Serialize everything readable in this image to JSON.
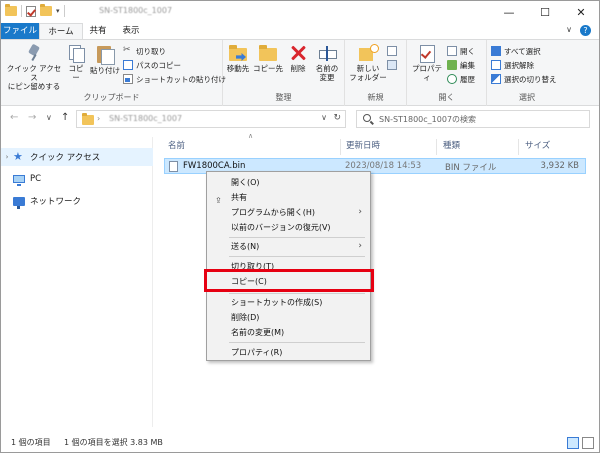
{
  "window": {
    "title": "SN-ST1800c_1007",
    "controls": {
      "minimize": "—",
      "maximize": "☐",
      "close": "✕"
    }
  },
  "quick_access_toolbar": {
    "dropdown": "▾"
  },
  "ribbon_tabs": {
    "file": "ファイル",
    "home": "ホーム",
    "share": "共有",
    "view": "表示"
  },
  "ribbon_right": {
    "expand": "∨",
    "help": "?"
  },
  "ribbon": {
    "clipboard": {
      "label": "クリップボード",
      "pin_label": "クイック アクセス\nにピン留めする",
      "copy_label": "コピー",
      "paste_label": "貼り付け",
      "cut_label": "切り取り",
      "copy_path_label": "パスのコピー",
      "paste_shortcut_label": "ショートカットの貼り付け"
    },
    "organize": {
      "label": "整理",
      "move_label": "移動先",
      "copyto_label": "コピー先",
      "delete_label": "削除",
      "rename_label": "名前の\n変更"
    },
    "new": {
      "label": "新規",
      "new_folder_label": "新しい\nフォルダー"
    },
    "open": {
      "label": "開く",
      "properties_label": "プロパティ",
      "open_label": "開く",
      "edit_label": "編集",
      "history_label": "履歴"
    },
    "select": {
      "label": "選択",
      "select_all_label": "すべて選択",
      "select_none_label": "選択解除",
      "invert_label": "選択の切り替え"
    }
  },
  "address": {
    "back": "←",
    "forward": "→",
    "recent": "∨",
    "up": "↑",
    "crumb_sep": "›",
    "path": "SN-ST1800c_1007",
    "dropdown": "∨",
    "refresh": "↻",
    "search_placeholder": "SN-ST1800c_1007の検索"
  },
  "nav_pane": {
    "items": [
      {
        "label": "クイック アクセス",
        "chevron": "›"
      },
      {
        "label": "PC",
        "chevron": ""
      },
      {
        "label": "ネットワーク",
        "chevron": ""
      }
    ]
  },
  "columns": {
    "sort_indicator": "∧",
    "name": "名前",
    "date": "更新日時",
    "type": "種類",
    "size": "サイズ"
  },
  "file": {
    "name": "FW1800CA.bin",
    "date": "2023/08/18 14:53",
    "type": "BIN ファイル",
    "size": "3,932 KB"
  },
  "context_menu": {
    "open": "開く(O)",
    "share": "共有",
    "open_with": "プログラムから開く(H)",
    "restore": "以前のバージョンの復元(V)",
    "send_to": "送る(N)",
    "cut": "切り取り(T)",
    "copy": "コピー(C)",
    "create_shortcut": "ショートカットの作成(S)",
    "delete": "削除(D)",
    "rename": "名前の変更(M)",
    "properties": "プロパティ(R)",
    "submenu_arrow": "›",
    "share_icon": "⇪"
  },
  "status": {
    "item_count": "1 個の項目",
    "selection": "1 個の項目を選択  3.83 MB"
  },
  "colors": {
    "accent": "#1979ca",
    "selection": "#cce8ff",
    "highlight_box": "#e60012"
  }
}
